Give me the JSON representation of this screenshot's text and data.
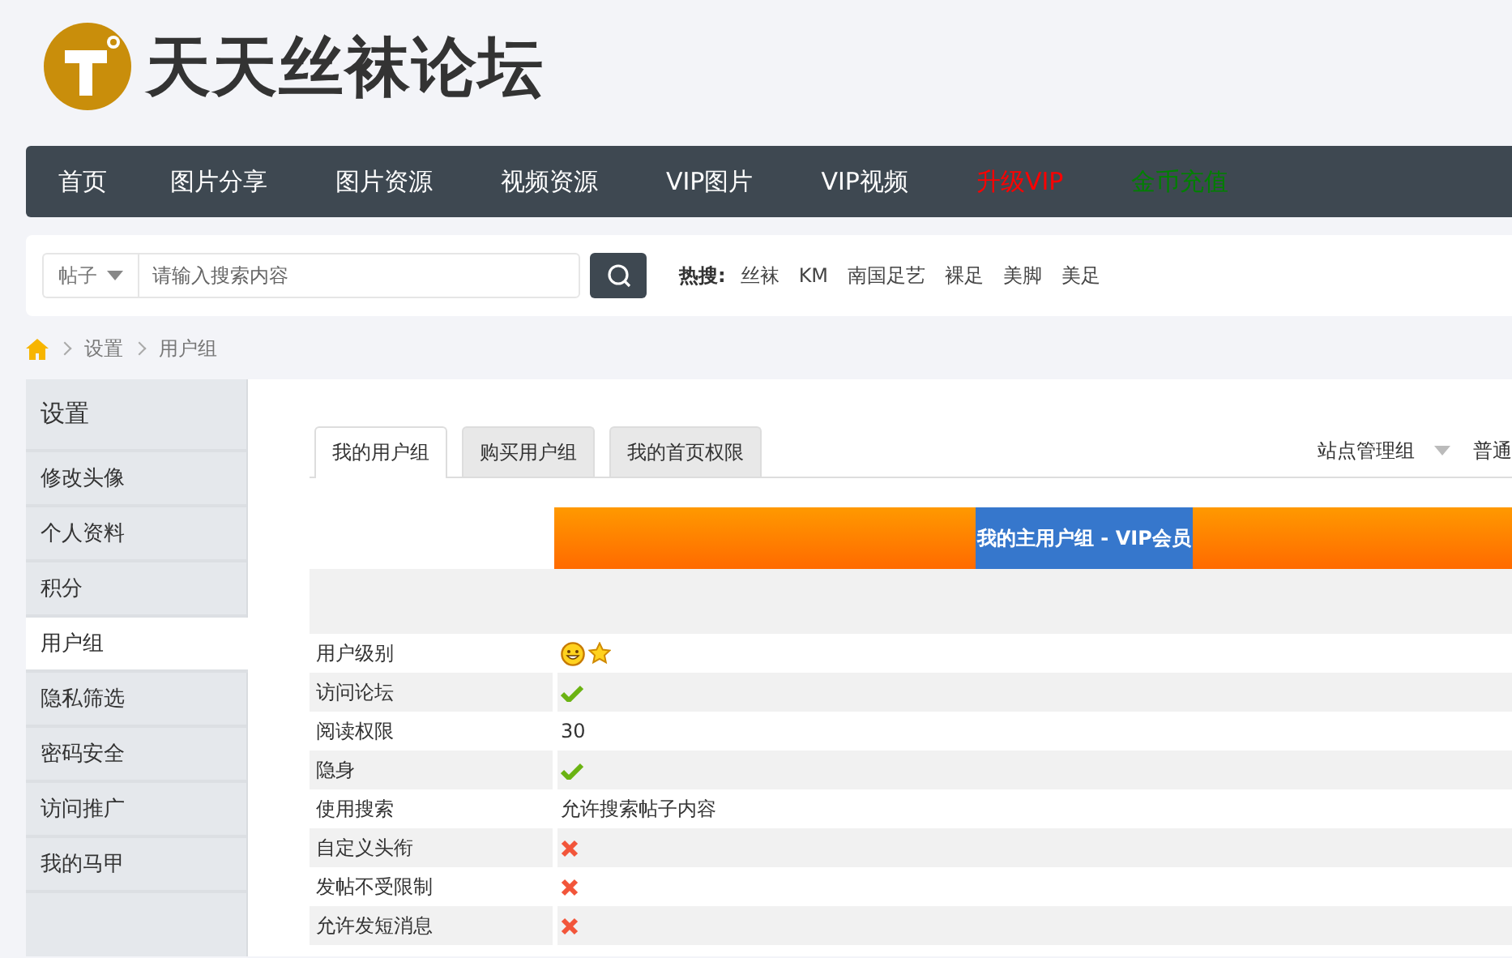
{
  "site": {
    "title": "天天丝袜论坛"
  },
  "nav": [
    {
      "label": "首页",
      "kind": "normal"
    },
    {
      "label": "图片分享",
      "kind": "normal"
    },
    {
      "label": "图片资源",
      "kind": "normal"
    },
    {
      "label": "视频资源",
      "kind": "normal"
    },
    {
      "label": "VIP图片",
      "kind": "normal"
    },
    {
      "label": "VIP视频",
      "kind": "normal"
    },
    {
      "label": "升级VIP",
      "kind": "upgrade"
    },
    {
      "label": "金币充值",
      "kind": "recharge"
    }
  ],
  "search": {
    "scope": "帖子",
    "placeholder": "请输入搜索内容",
    "hot_label": "热搜:",
    "hot": [
      "丝袜",
      "KM",
      "南国足艺",
      "裸足",
      "美脚",
      "美足"
    ]
  },
  "breadcrumb": [
    "设置",
    "用户组"
  ],
  "sidebar": {
    "title": "设置",
    "items": [
      {
        "label": "修改头像",
        "selected": false
      },
      {
        "label": "个人资料",
        "selected": false
      },
      {
        "label": "积分",
        "selected": false
      },
      {
        "label": "用户组",
        "selected": true
      },
      {
        "label": "隐私筛选",
        "selected": false
      },
      {
        "label": "密码安全",
        "selected": false
      },
      {
        "label": "访问推广",
        "selected": false
      },
      {
        "label": "我的马甲",
        "selected": false
      }
    ]
  },
  "tabs": [
    {
      "label": "我的用户组",
      "selected": true
    },
    {
      "label": "购买用户组",
      "selected": false
    },
    {
      "label": "我的首页权限",
      "selected": false
    }
  ],
  "group_switch": {
    "current": "站点管理组",
    "next": "普通"
  },
  "group_header": "我的主用户组 - VIP会员",
  "rows": [
    {
      "label": "用户级别",
      "kind": "level"
    },
    {
      "label": "访问论坛",
      "kind": "yes"
    },
    {
      "label": "阅读权限",
      "kind": "text",
      "value": "30"
    },
    {
      "label": "隐身",
      "kind": "yes"
    },
    {
      "label": "使用搜索",
      "kind": "text",
      "value": "允许搜索帖子内容"
    },
    {
      "label": "自定义头衔",
      "kind": "no"
    },
    {
      "label": "发帖不受限制",
      "kind": "no"
    },
    {
      "label": "允许发短消息",
      "kind": "no"
    }
  ]
}
